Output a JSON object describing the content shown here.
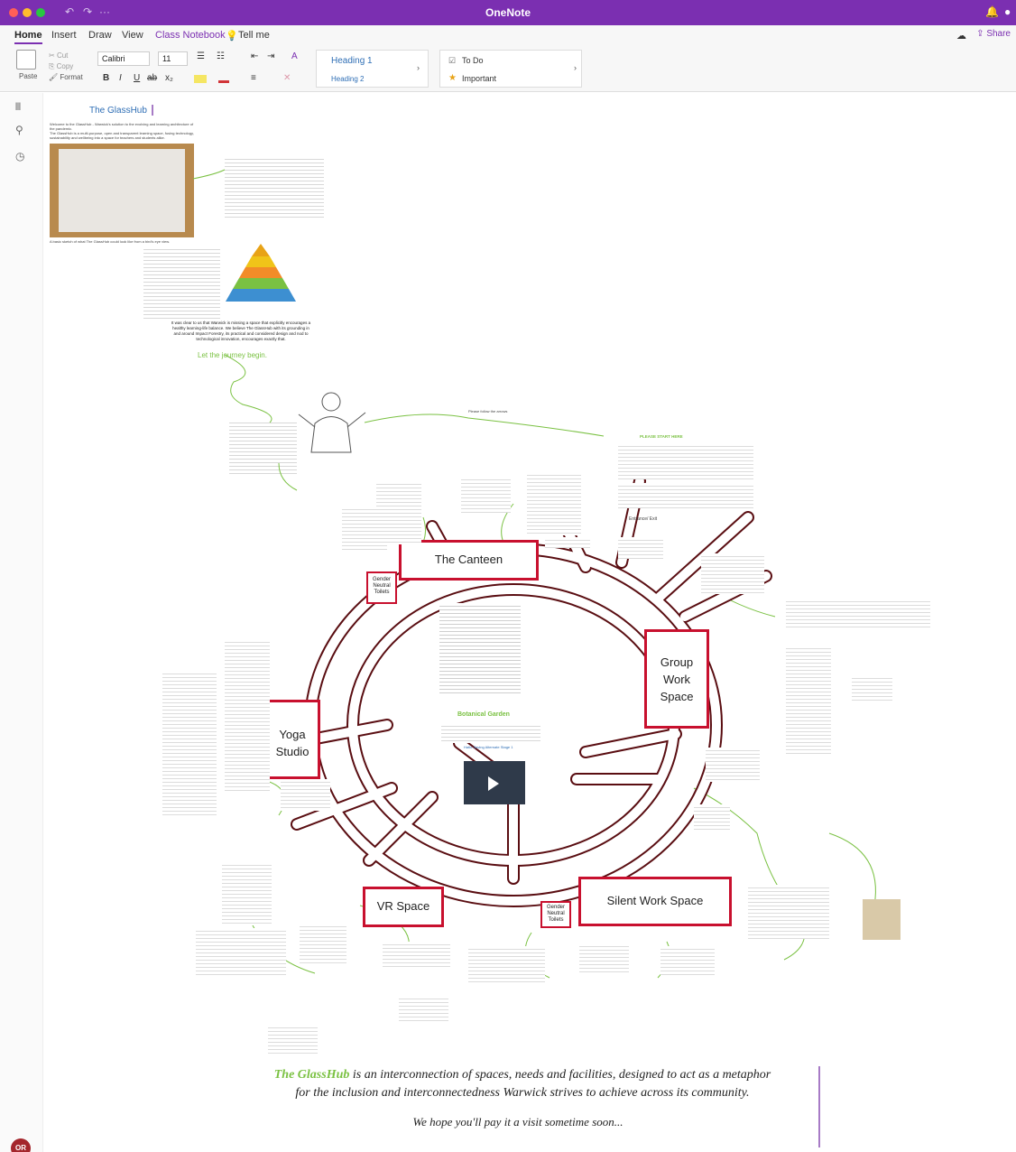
{
  "window": {
    "app_title": "OneNote"
  },
  "tabs": [
    "Home",
    "Insert",
    "Draw",
    "View",
    "Class Notebook",
    "Tell me"
  ],
  "share_label": "Share",
  "clipboard": {
    "paste": "Paste",
    "cut": "Cut",
    "copy": "Copy",
    "format": "Format"
  },
  "font": {
    "name": "Calibri",
    "size": "11"
  },
  "format_buttons": [
    "B",
    "I",
    "U",
    "ab",
    "x₂"
  ],
  "styles": {
    "heading1": "Heading 1",
    "heading2": "Heading 2"
  },
  "tags": {
    "todo": "To Do",
    "important": "Important"
  },
  "user_initials": "OR",
  "page": {
    "title": "The GlassHub",
    "intro_line1": "Welcome to the GlassHub - Warwick's solution to the evolving and learning architecture of the pandemic.",
    "intro_line2": "The GlassHub is a multi-purpose, open and transparent learning space, fusing technology, sustainability and wellbeing into a space for teachers and students alike.",
    "sketch_caption": "A basic sketch of what The GlassHub could look like from a bird's eye view.",
    "journey_text": "Let the journey begin.",
    "follow_text": "Please follow the arrows",
    "start_here": "PLEASE START HERE",
    "entrance": "Entrance/ Exit",
    "botanical_garden": "Botanical Garden",
    "video_link": "Hatlo Saving Alternate Stage 1",
    "maslow_quote": "It was clear to us that Warwick is missing a space that explicitly encourages a healthy learning-life balance. We believe The GlassHub with its grounding in and around Impact Forestry, its practical and considered design and nod to technological innovation, encourages exactly that."
  },
  "map": {
    "canteen": "The Canteen",
    "group_work": "Group Work Space",
    "yoga": "Yoga Studio",
    "vr": "VR Space",
    "silent": "Silent Work Space",
    "toilets_top": "Gender Neutral Toilets",
    "toilets_bottom": "Gender Neutral Toilets"
  },
  "closing": {
    "highlight": "The GlassHub",
    "line1_rest": " is an interconnection of spaces, needs and facilities, designed to act as a metaphor",
    "line2": "for the inclusion and interconnectedness Warwick strives to achieve across its community.",
    "line3": "We hope you'll pay it a visit sometime soon..."
  },
  "colors": {
    "titlebar": "#7b2fb1",
    "road_red": "#c8102e",
    "green": "#7ac142",
    "heading_blue": "#2e6eb5"
  }
}
